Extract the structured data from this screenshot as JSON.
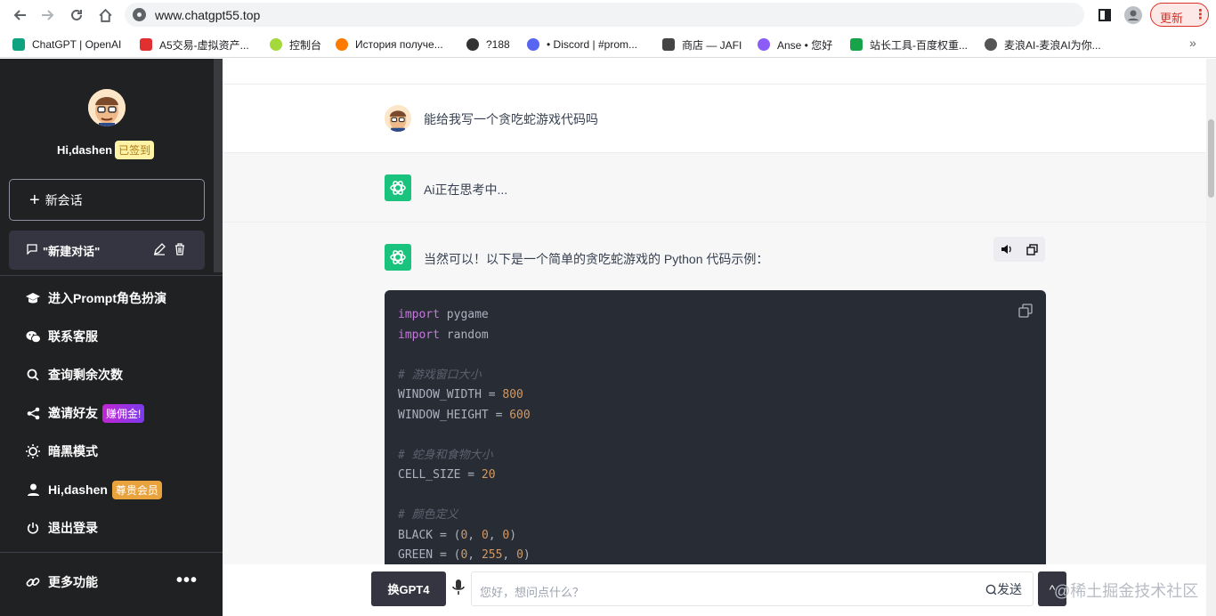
{
  "browser": {
    "url": "www.chatgpt55.top",
    "update_label": "更新",
    "update_menu": "⋮",
    "bookmarks": [
      {
        "label": "ChatGPT | OpenAI",
        "color": "#10a37f"
      },
      {
        "label": "A5交易-虚拟资产...",
        "color": "#e03030"
      },
      {
        "label": "控制台",
        "color": "#a3d93b"
      },
      {
        "label": "История получе...",
        "color": "#ff7a00"
      },
      {
        "label": "?188",
        "color": "#333333"
      },
      {
        "label": "• Discord | #prom...",
        "color": "#5865f2"
      },
      {
        "label": "商店 — JAFI",
        "color": "#444444"
      },
      {
        "label": "Anse • 您好",
        "color": "#8b5cf6"
      },
      {
        "label": "站长工具-百度权重...",
        "color": "#16a34a"
      },
      {
        "label": "麦浪AI-麦浪AI为你...",
        "color": "#555555"
      }
    ],
    "more_label": "»"
  },
  "sidebar": {
    "greeting": "Hi,dashen",
    "checkin_badge": "已签到",
    "new_chat_label": "新会话",
    "conversation_title": "\"新建对话\"",
    "menu": [
      {
        "label": "进入Prompt角色扮演",
        "icon": "graduation-cap-icon"
      },
      {
        "label": "联系客服",
        "icon": "wechat-icon"
      },
      {
        "label": "查询剩余次数",
        "icon": "search-icon"
      },
      {
        "label": "邀请好友",
        "icon": "share-icon",
        "badge": "赚佣金!"
      },
      {
        "label": "暗黑模式",
        "icon": "sun-icon"
      },
      {
        "label": "Hi,dashen",
        "icon": "user-icon",
        "badge": "尊贵会员"
      },
      {
        "label": "退出登录",
        "icon": "power-icon"
      }
    ],
    "more_label": "更多功能",
    "more_dots": "•••"
  },
  "chat": {
    "user_message": "能给我写一个贪吃蛇游戏代码吗",
    "thinking_message": "Ai正在思考中...",
    "answer_intro": "当然可以！以下是一个简单的贪吃蛇游戏的 Python 代码示例：",
    "code_lines": [
      {
        "t": "kw",
        "a": "import",
        "b": " pygame"
      },
      {
        "t": "kw",
        "a": "import",
        "b": " random"
      },
      {
        "t": "blank"
      },
      {
        "t": "cm",
        "a": "# 游戏窗口大小"
      },
      {
        "t": "num",
        "a": "WINDOW_WIDTH = ",
        "b": "800"
      },
      {
        "t": "num",
        "a": "WINDOW_HEIGHT = ",
        "b": "600"
      },
      {
        "t": "blank"
      },
      {
        "t": "cm",
        "a": "# 蛇身和食物大小"
      },
      {
        "t": "num",
        "a": "CELL_SIZE = ",
        "b": "20"
      },
      {
        "t": "blank"
      },
      {
        "t": "cm",
        "a": "# 颜色定义"
      },
      {
        "t": "rgb",
        "a": "BLACK = (",
        "n": [
          "0",
          "0",
          "0"
        ]
      },
      {
        "t": "rgb",
        "a": "GREEN = (",
        "n": [
          "0",
          "255",
          "0"
        ]
      }
    ]
  },
  "input": {
    "gpt4_label": "换GPT4",
    "placeholder": "您好，想问点什么？",
    "send_label": "发送",
    "up_label": "^"
  },
  "watermark": "@稀土掘金技术社区"
}
